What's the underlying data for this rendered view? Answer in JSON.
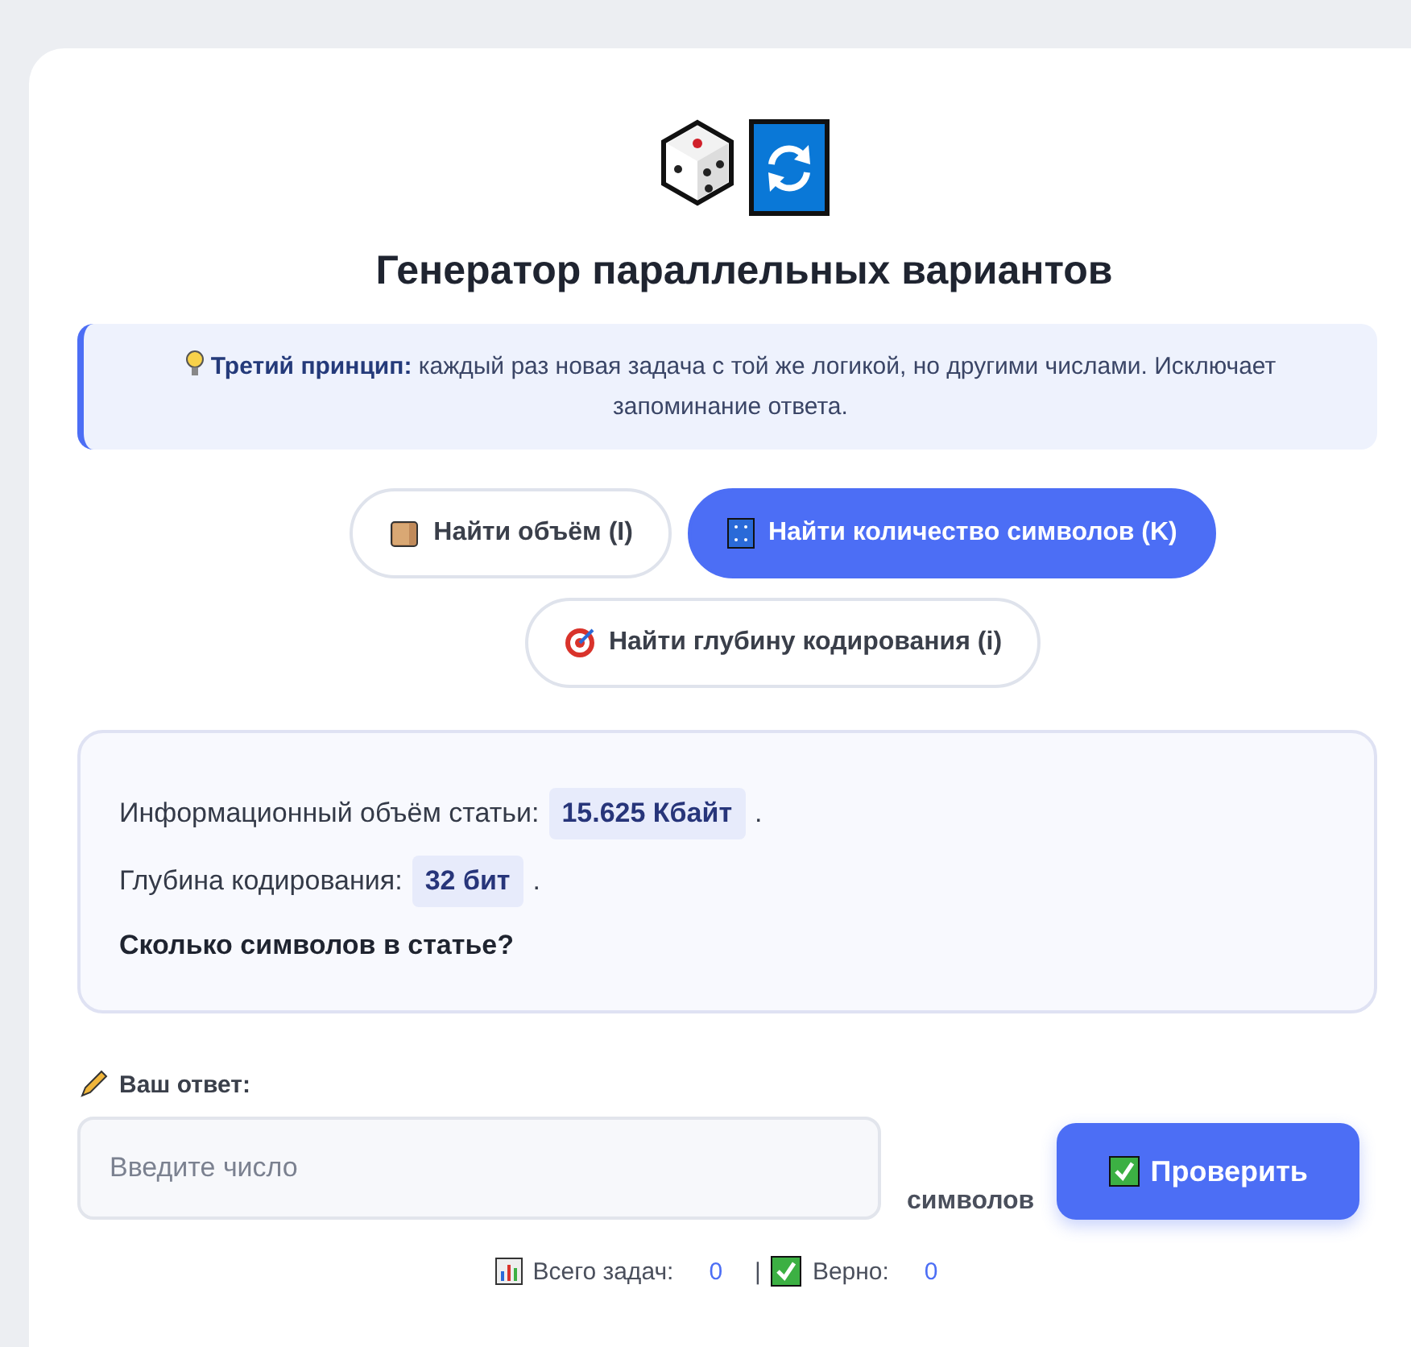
{
  "title": "Генератор параллельных вариантов",
  "principle": {
    "text": "**Третий принцип:** каждый раз новая задача с той же логикой, но другими числами. Исключает запоминание ответа."
  },
  "modes": [
    {
      "kind": "volume",
      "label": "Найти объём (I)",
      "selected": false
    },
    {
      "kind": "count",
      "label": "Найти количество символов (K)",
      "selected": true
    },
    {
      "kind": "depth",
      "label": "Найти глубину кодирования (i)",
      "selected": false
    }
  ],
  "task": {
    "facts": [
      {
        "label": "Информационный объём статьи:",
        "value": "15.625 Кбайт",
        "end": "."
      },
      {
        "label": "Глубина кодирования:",
        "value": "32 бит",
        "end": "."
      }
    ],
    "question": "Сколько символов в статье?"
  },
  "answer": {
    "label": "Ваш ответ:",
    "placeholder": "Введите число",
    "unit": "символов",
    "button": "Проверить"
  },
  "stats": [
    {
      "kind": "chart",
      "label": "Всего задач:",
      "value": "0"
    },
    {
      "kind": "separator",
      "label": "|"
    },
    {
      "kind": "check",
      "label": "Верно:",
      "value": "0"
    }
  ]
}
